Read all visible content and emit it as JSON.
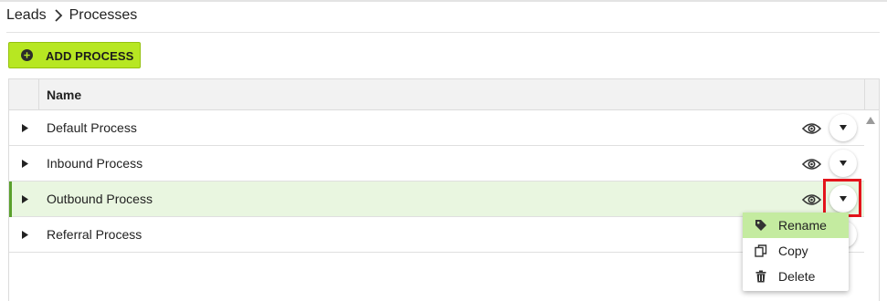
{
  "breadcrumb": {
    "parent": "Leads",
    "current": "Processes"
  },
  "toolbar": {
    "add_label": "ADD PROCESS"
  },
  "grid": {
    "column_name": "Name",
    "rows": [
      {
        "name": "Default Process",
        "selected": false
      },
      {
        "name": "Inbound Process",
        "selected": false
      },
      {
        "name": "Outbound Process",
        "selected": true
      },
      {
        "name": "Referral Process",
        "selected": false
      }
    ]
  },
  "context_menu": {
    "items": [
      {
        "label": "Rename",
        "icon": "tag-icon",
        "active": true
      },
      {
        "label": "Copy",
        "icon": "copy-icon",
        "active": false
      },
      {
        "label": "Delete",
        "icon": "trash-icon",
        "active": false
      }
    ]
  },
  "colors": {
    "accent_green": "#b7e722",
    "selected_row": "#e9f6e0",
    "selected_accent": "#5aa02c",
    "menu_active": "#c4eba0",
    "highlight": "#e3141b"
  }
}
